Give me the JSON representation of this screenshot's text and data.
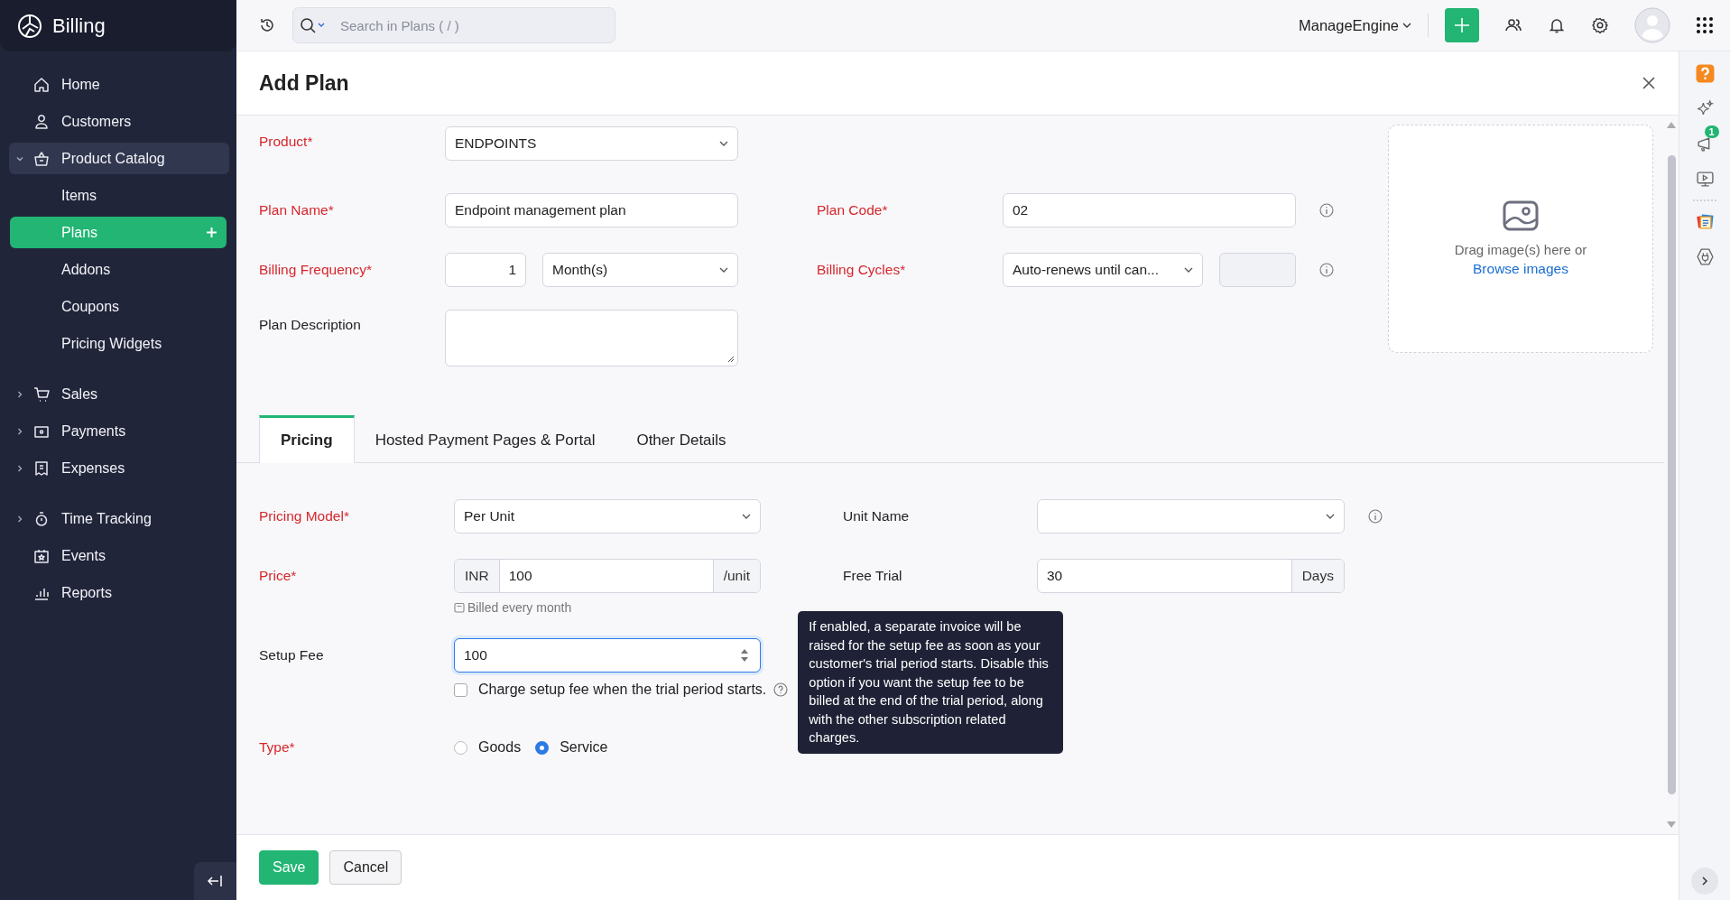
{
  "app": {
    "name": "Billing"
  },
  "sidebar": {
    "items": [
      {
        "label": "Home",
        "selected": false
      },
      {
        "label": "Customers",
        "selected": false
      },
      {
        "label": "Product Catalog",
        "selected": false,
        "expanded": true,
        "children": [
          {
            "label": "Items",
            "selected": false
          },
          {
            "label": "Plans",
            "selected": true
          },
          {
            "label": "Addons",
            "selected": false
          },
          {
            "label": "Coupons",
            "selected": false
          },
          {
            "label": "Pricing Widgets",
            "selected": false
          }
        ]
      },
      {
        "label": "Sales",
        "selected": false,
        "expanded": false
      },
      {
        "label": "Payments",
        "selected": false,
        "expanded": false
      },
      {
        "label": "Expenses",
        "selected": false,
        "expanded": false
      },
      {
        "label": "Time Tracking",
        "selected": false,
        "expanded": false
      },
      {
        "label": "Events",
        "selected": false
      },
      {
        "label": "Reports",
        "selected": false
      }
    ]
  },
  "topbar": {
    "search_placeholder": "Search in Plans ( / )",
    "organization": "ManageEngine"
  },
  "rail": {
    "notification_count": "1"
  },
  "title": "Add Plan",
  "plan": {
    "product": {
      "label": "Product*",
      "required": true,
      "value": "ENDPOINTS"
    },
    "plan_name": {
      "label": "Plan Name*",
      "required": true,
      "value": "Endpoint management plan"
    },
    "plan_code": {
      "label": "Plan Code*",
      "required": true,
      "value": "02"
    },
    "billing_frequency": {
      "label": "Billing Frequency*",
      "required": true,
      "count": "1",
      "unit": "Month(s)"
    },
    "billing_cycles": {
      "label": "Billing Cycles*",
      "required": true,
      "value": "Auto-renews until can..."
    },
    "plan_description": {
      "label": "Plan Description",
      "required": false
    },
    "image_upload": {
      "hint": "Drag image(s) here or",
      "link": "Browse images"
    }
  },
  "tabs": [
    {
      "label": "Pricing",
      "selected": true
    },
    {
      "label": "Hosted Payment Pages & Portal",
      "selected": false
    },
    {
      "label": "Other Details",
      "selected": false
    }
  ],
  "pricing": {
    "pricing_model": {
      "label": "Pricing Model*",
      "required": true,
      "value": "Per Unit"
    },
    "unit_name": {
      "label": "Unit Name",
      "required": false
    },
    "price": {
      "label": "Price*",
      "required": true,
      "currency": "INR",
      "value": "100",
      "suffix": "/unit",
      "note": "Billed every month"
    },
    "free_trial": {
      "label": "Free Trial",
      "required": false,
      "value": "30",
      "suffix": "Days"
    },
    "setup_fee": {
      "label": "Setup Fee",
      "required": false,
      "value": "100",
      "focused": true
    },
    "charge_setup": {
      "label": "Charge setup fee when the trial period starts.",
      "checked": false
    },
    "type": {
      "label": "Type*",
      "required": true,
      "options": [
        {
          "label": "Goods",
          "selected": false
        },
        {
          "label": "Service",
          "selected": true
        }
      ]
    },
    "tooltip": "If enabled, a separate invoice will be raised for the setup fee as soon as your customer's trial period starts. Disable this option if you want the setup fee to be billed at the end of the trial period, along with the other subscription related charges."
  },
  "buttons": [
    {
      "label": "Save",
      "kind": "primary"
    },
    {
      "label": "Cancel",
      "kind": "secondary"
    }
  ]
}
